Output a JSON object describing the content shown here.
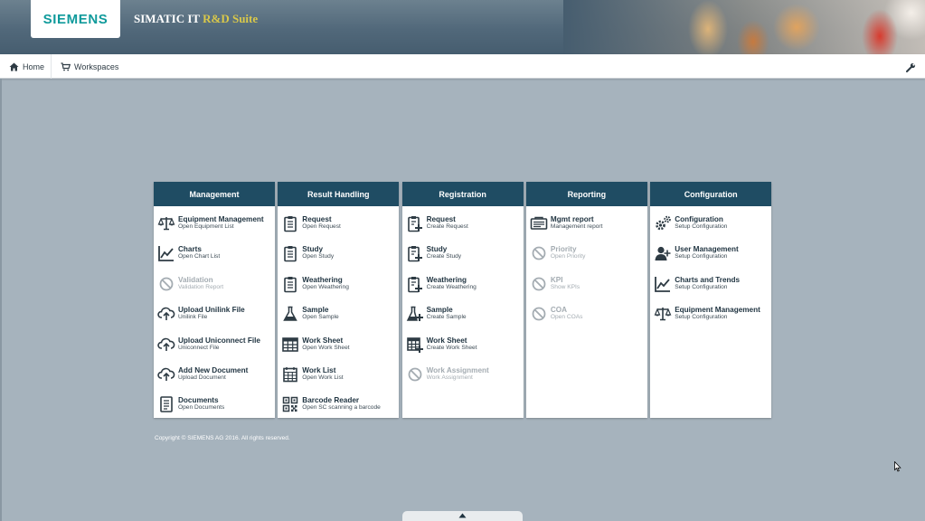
{
  "header": {
    "logo": "SIEMENS",
    "title_main": "SIMATIC IT ",
    "title_accent": "R&D Suite",
    "accent_color": "#d9c84a"
  },
  "nav": {
    "home_label": "Home",
    "workspaces_label": "Workspaces",
    "settings_icon": "wrench-icon"
  },
  "tiles": [
    {
      "title": "Management",
      "items": [
        {
          "title": "Equipment Management",
          "subtitle": "Open Equipment List",
          "icon": "balance-scale-icon",
          "enabled": true
        },
        {
          "title": "Charts",
          "subtitle": "Open Chart List",
          "icon": "line-chart-icon",
          "enabled": true
        },
        {
          "title": "Validation",
          "subtitle": "Validation Report",
          "icon": "prohibited-icon",
          "enabled": false
        },
        {
          "title": "Upload Unilink File",
          "subtitle": "Unilink File",
          "icon": "cloud-upload-icon",
          "enabled": true
        },
        {
          "title": "Upload Uniconnect File",
          "subtitle": "Uniconnect File",
          "icon": "cloud-upload-icon",
          "enabled": true
        },
        {
          "title": "Add New Document",
          "subtitle": "Upload Document",
          "icon": "cloud-upload-icon",
          "enabled": true
        },
        {
          "title": "Documents",
          "subtitle": "Open Documents",
          "icon": "document-icon",
          "enabled": true
        }
      ]
    },
    {
      "title": "Result Handling",
      "items": [
        {
          "title": "Request",
          "subtitle": "Open Request",
          "icon": "clipboard-list-icon",
          "enabled": true
        },
        {
          "title": "Study",
          "subtitle": "Open Study",
          "icon": "clipboard-list-icon",
          "enabled": true
        },
        {
          "title": "Weathering",
          "subtitle": "Open Weathering",
          "icon": "clipboard-list-icon",
          "enabled": true
        },
        {
          "title": "Sample",
          "subtitle": "Open Sample",
          "icon": "flask-icon",
          "enabled": true
        },
        {
          "title": "Work Sheet",
          "subtitle": "Open Work Sheet",
          "icon": "table-icon",
          "enabled": true
        },
        {
          "title": "Work List",
          "subtitle": "Open Work List",
          "icon": "calendar-grid-icon",
          "enabled": true
        },
        {
          "title": "Barcode Reader",
          "subtitle": "Open SC scanning a barcode",
          "icon": "qr-code-icon",
          "enabled": true
        }
      ]
    },
    {
      "title": "Registration",
      "items": [
        {
          "title": "Request",
          "subtitle": "Create Request",
          "icon": "clipboard-add-icon",
          "enabled": true
        },
        {
          "title": "Study",
          "subtitle": "Create Study",
          "icon": "clipboard-add-icon",
          "enabled": true
        },
        {
          "title": "Weathering",
          "subtitle": "Create Weathering",
          "icon": "clipboard-add-icon",
          "enabled": true
        },
        {
          "title": "Sample",
          "subtitle": "Create Sample",
          "icon": "flask-add-icon",
          "enabled": true
        },
        {
          "title": "Work Sheet",
          "subtitle": "Create Work Sheet",
          "icon": "table-add-icon",
          "enabled": true
        },
        {
          "title": "Work Assignment",
          "subtitle": "Work Assignment",
          "icon": "prohibited-icon",
          "enabled": false
        }
      ]
    },
    {
      "title": "Reporting",
      "items": [
        {
          "title": "Mgmt report",
          "subtitle": "Management report",
          "icon": "report-icon",
          "enabled": true
        },
        {
          "title": "Priority",
          "subtitle": "Open Priority",
          "icon": "prohibited-icon",
          "enabled": false
        },
        {
          "title": "KPI",
          "subtitle": "Show KPIs",
          "icon": "prohibited-icon",
          "enabled": false
        },
        {
          "title": "COA",
          "subtitle": "Open COAs",
          "icon": "prohibited-icon",
          "enabled": false
        }
      ]
    },
    {
      "title": "Configuration",
      "items": [
        {
          "title": "Configuration",
          "subtitle": "Setup Configuration",
          "icon": "gears-icon",
          "enabled": true
        },
        {
          "title": "User Management",
          "subtitle": "Setup Configuration",
          "icon": "user-icon",
          "enabled": true
        },
        {
          "title": "Charts and Trends",
          "subtitle": "Setup Configuration",
          "icon": "line-chart-icon",
          "enabled": true
        },
        {
          "title": "Equipment Management",
          "subtitle": "Setup Configuration",
          "icon": "balance-scale-icon",
          "enabled": true
        }
      ]
    }
  ],
  "footer": {
    "copyright": "Copyright © SIEMENS AG 2016. All rights reserved."
  },
  "colors": {
    "tile_header": "#1f4c63",
    "background": "#a6b3bd",
    "icon": "#2e3b44",
    "disabled": "#a4acb2"
  }
}
